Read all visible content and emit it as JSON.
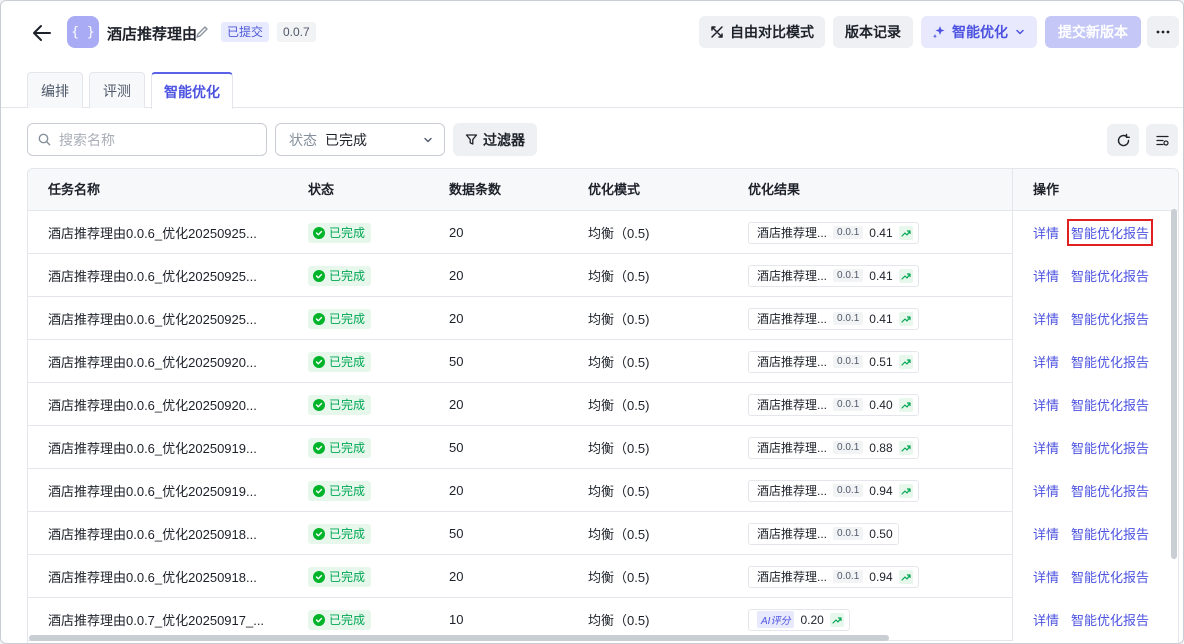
{
  "header": {
    "app_icon": "{ }",
    "title": "酒店推荐理由",
    "status": "已提交",
    "version": "0.0.7",
    "buttons": {
      "compare": "自由对比模式",
      "history": "版本记录",
      "smart": "智能优化",
      "submit": "提交新版本"
    }
  },
  "tabs": [
    "编排",
    "评测",
    "智能优化"
  ],
  "toolbar": {
    "search_placeholder": "搜索名称",
    "status_label": "状态",
    "status_value": "已完成",
    "filter_label": "过滤器"
  },
  "table": {
    "columns": [
      "任务名称",
      "状态",
      "数据条数",
      "优化模式",
      "优化结果",
      "操作"
    ],
    "rows": [
      {
        "name": "酒店推荐理由0.0.6_优化20250925...",
        "status": "已完成",
        "count": "20",
        "mode": "均衡（0.5)",
        "result_name": "酒店推荐理...",
        "result_ver": "0.0.1",
        "score": "0.41",
        "detail": "详情",
        "report": "智能优化报告"
      },
      {
        "name": "酒店推荐理由0.0.6_优化20250925...",
        "status": "已完成",
        "count": "20",
        "mode": "均衡（0.5)",
        "result_name": "酒店推荐理...",
        "result_ver": "0.0.1",
        "score": "0.41",
        "detail": "详情",
        "report": "智能优化报告"
      },
      {
        "name": "酒店推荐理由0.0.6_优化20250925...",
        "status": "已完成",
        "count": "20",
        "mode": "均衡（0.5)",
        "result_name": "酒店推荐理...",
        "result_ver": "0.0.1",
        "score": "0.41",
        "detail": "详情",
        "report": "智能优化报告"
      },
      {
        "name": "酒店推荐理由0.0.6_优化20250920...",
        "status": "已完成",
        "count": "50",
        "mode": "均衡（0.5)",
        "result_name": "酒店推荐理...",
        "result_ver": "0.0.1",
        "score": "0.51",
        "detail": "详情",
        "report": "智能优化报告"
      },
      {
        "name": "酒店推荐理由0.0.6_优化20250920...",
        "status": "已完成",
        "count": "20",
        "mode": "均衡（0.5)",
        "result_name": "酒店推荐理...",
        "result_ver": "0.0.1",
        "score": "0.40",
        "detail": "详情",
        "report": "智能优化报告"
      },
      {
        "name": "酒店推荐理由0.0.6_优化20250919...",
        "status": "已完成",
        "count": "50",
        "mode": "均衡（0.5)",
        "result_name": "酒店推荐理...",
        "result_ver": "0.0.1",
        "score": "0.88",
        "detail": "详情",
        "report": "智能优化报告"
      },
      {
        "name": "酒店推荐理由0.0.6_优化20250919...",
        "status": "已完成",
        "count": "20",
        "mode": "均衡（0.5)",
        "result_name": "酒店推荐理...",
        "result_ver": "0.0.1",
        "score": "0.94",
        "detail": "详情",
        "report": "智能优化报告"
      },
      {
        "name": "酒店推荐理由0.0.6_优化20250918...",
        "status": "已完成",
        "count": "50",
        "mode": "均衡（0.5)",
        "result_name": "酒店推荐理...",
        "result_ver": "0.0.1",
        "score": "0.50",
        "detail": "详情",
        "report": "智能优化报告"
      },
      {
        "name": "酒店推荐理由0.0.6_优化20250918...",
        "status": "已完成",
        "count": "20",
        "mode": "均衡（0.5)",
        "result_name": "酒店推荐理...",
        "result_ver": "0.0.1",
        "score": "0.94",
        "detail": "详情",
        "report": "智能优化报告"
      },
      {
        "name": "酒店推荐理由0.0.7_优化20250917_...",
        "status": "已完成",
        "count": "10",
        "mode": "均衡（0.5)",
        "result_ai": "AI评分",
        "score": "0.20",
        "detail": "详情",
        "report": "智能优化报告"
      }
    ]
  },
  "icons": {
    "back": "arrow-left-icon",
    "edit": "pencil-icon",
    "compare": "compare-icon",
    "smart": "sparkle-icon",
    "more": "more-horizontal-icon",
    "search": "search-icon",
    "chevron": "chevron-down-icon",
    "filter": "filter-icon",
    "refresh": "refresh-icon",
    "columns": "column-settings-icon",
    "check": "check-circle-icon",
    "trend": "trend-up-icon"
  },
  "colors": {
    "accent": "#4d53e0",
    "success": "#00b42a",
    "highlight": "#e02020"
  }
}
